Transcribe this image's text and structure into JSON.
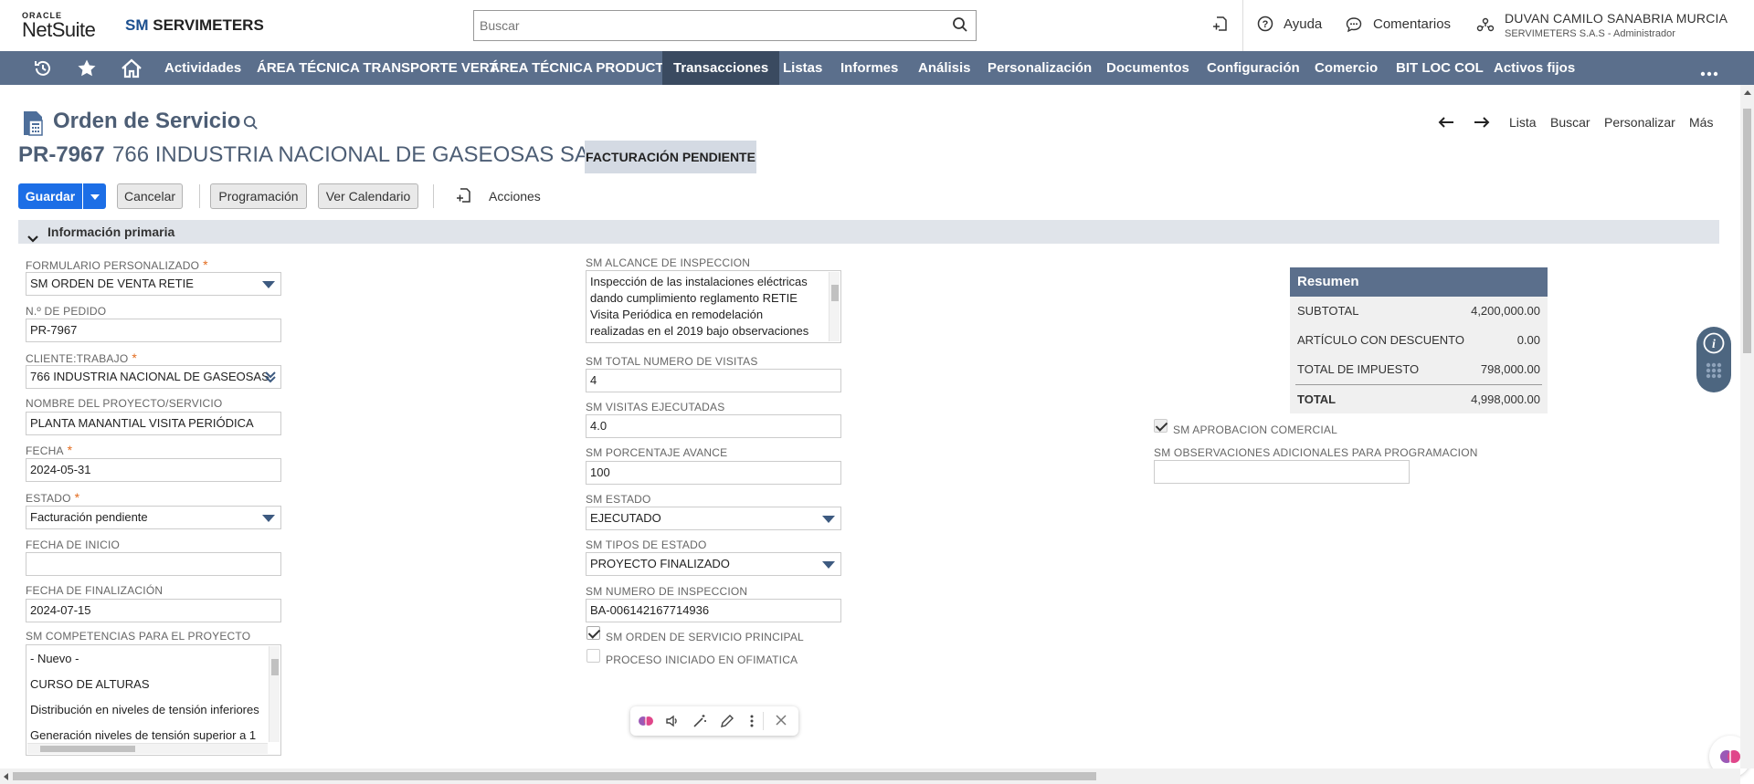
{
  "header": {
    "oracle": "ORACLE",
    "netsuite": "NetSuite",
    "brand_sm": "SM",
    "brand_name": "SERVIMETERS",
    "search_placeholder": "Buscar",
    "help": "Ayuda",
    "comments": "Comentarios",
    "user_name": "DUVAN CAMILO SANABRIA MURCIA",
    "user_role": "SERVIMETERS S.A.S - Administrador"
  },
  "nav": {
    "items": [
      "Actividades",
      "ÁREA TÉCNICA TRANSPORTE VERT.",
      "ÁREA TÉCNICA PRODUCTO",
      "Transacciones",
      "Listas",
      "Informes",
      "Análisis",
      "Personalización",
      "Documentos",
      "Configuración",
      "Comercio",
      "BIT LOC COL",
      "Activos fijos"
    ],
    "active": "Transacciones",
    "bg_color": "#5b6f8c"
  },
  "page": {
    "title": "Orden de Servicio",
    "record_id": "PR-7967",
    "record_name": "766 INDUSTRIA NACIONAL DE GASEOSAS SA",
    "status": "FACTURACIÓN PENDIENTE",
    "nav_list": "Lista",
    "nav_search": "Buscar",
    "nav_customize": "Personalizar",
    "nav_more": "Más"
  },
  "buttons": {
    "save": "Guardar",
    "cancel": "Cancelar",
    "schedule": "Programación",
    "calendar": "Ver Calendario",
    "actions": "Acciones"
  },
  "section": {
    "primary": "Información primaria"
  },
  "left": {
    "form_label": "FORMULARIO PERSONALIZADO",
    "form_value": "SM ORDEN DE VENTA RETIE",
    "order_label": "N.º DE PEDIDO",
    "order_value": "PR-7967",
    "client_label": "CLIENTE:TRABAJO",
    "client_value": "766 INDUSTRIA NACIONAL DE GASEOSAS",
    "project_label": "NOMBRE DEL PROYECTO/SERVICIO",
    "project_value": "PLANTA MANANTIAL VISITA PERIÓDICA",
    "date_label": "FECHA",
    "date_value": "2024-05-31",
    "state_label": "ESTADO",
    "state_value": "Facturación pendiente",
    "start_label": "FECHA DE INICIO",
    "start_value": "",
    "end_label": "FECHA DE FINALIZACIÓN",
    "end_value": "2024-07-15",
    "comp_label": "SM COMPETENCIAS PARA EL PROYECTO",
    "comp_items": [
      "- Nuevo -",
      "CURSO DE ALTURAS",
      "Distribución en niveles de tensión inferiores",
      "Generación niveles de tensión superior a 1"
    ]
  },
  "middle": {
    "scope_label": "SM ALCANCE DE INSPECCION",
    "scope_lines": [
      "Inspección de las instalaciones eléctricas",
      "dando cumplimiento reglamento RETIE",
      "Visita Periódica en remodelación",
      "realizadas en el 2019 bajo observaciones"
    ],
    "visits_total_label": "SM TOTAL NUMERO DE VISITAS",
    "visits_total_value": "4",
    "visits_done_label": "SM VISITAS EJECUTADAS",
    "visits_done_value": "4.0",
    "progress_label": "SM PORCENTAJE AVANCE",
    "progress_value": "100",
    "sm_state_label": "SM ESTADO",
    "sm_state_value": "EJECUTADO",
    "state_types_label": "SM TIPOS DE ESTADO",
    "state_types_value": "PROYECTO FINALIZADO",
    "inspection_label": "SM NUMERO DE INSPECCION",
    "inspection_value": "BA-006142167714936",
    "principal_label": "SM ORDEN DE SERVICIO PRINCIPAL",
    "ofimatica_label": "PROCESO INICIADO EN OFIMATICA"
  },
  "right": {
    "approval_label": "SM APROBACION COMERCIAL",
    "observations_label": "SM OBSERVACIONES ADICIONALES PARA PROGRAMACION",
    "observations_value": ""
  },
  "summary": {
    "title": "Resumen",
    "subtotal_label": "SUBTOTAL",
    "subtotal_value": "4,200,000.00",
    "discount_label": "ARTÍCULO CON DESCUENTO",
    "discount_value": "0.00",
    "tax_label": "TOTAL DE IMPUESTO",
    "tax_value": "798,000.00",
    "total_label": "TOTAL",
    "total_value": "4,998,000.00"
  },
  "colors": {
    "primary_button": "#1c6ee6",
    "title_color": "#4d5e75",
    "required": "#e36c1f"
  }
}
